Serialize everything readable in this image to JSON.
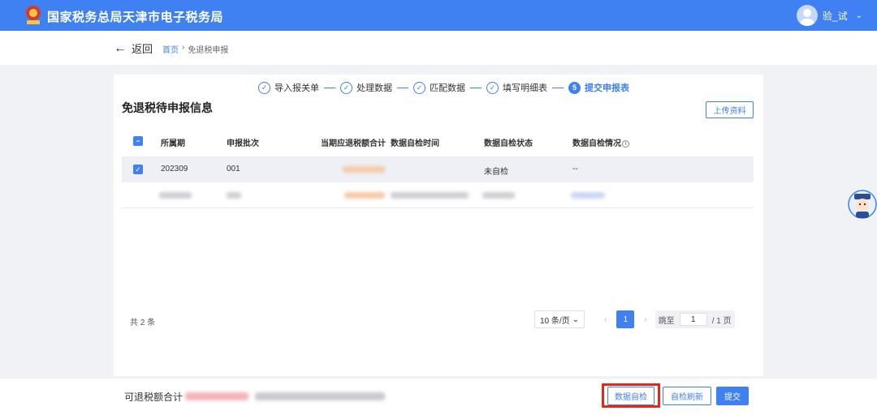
{
  "header": {
    "title": "国家税务总局天津市电子税务局",
    "user_name": "验_试",
    "colors": {
      "brand": "#3f80f2",
      "highlight": "#e4261b"
    }
  },
  "nav": {
    "back_label": "返回",
    "breadcrumb": [
      "首页",
      "免退税申报"
    ],
    "breadcrumb_sep": "›"
  },
  "steps": [
    {
      "label": "导入报关单",
      "status": "done"
    },
    {
      "label": "处理数据",
      "status": "done"
    },
    {
      "label": "匹配数据",
      "status": "done"
    },
    {
      "label": "填写明细表",
      "status": "done"
    },
    {
      "label": "提交申报表",
      "status": "active",
      "number": "5"
    }
  ],
  "section": {
    "title": "免退税待申报信息",
    "upload_label": "上传资料"
  },
  "table": {
    "columns": [
      "所属期",
      "申报批次",
      "当期应退税额合计",
      "数据自检时间",
      "数据自检状态",
      "数据自检情况"
    ],
    "rows": [
      {
        "period": "202309",
        "batch": "001",
        "refund": "",
        "check_time": "",
        "check_status": "未自检",
        "check_detail": "--",
        "selected": true
      }
    ]
  },
  "pagination": {
    "total": "共 2 条",
    "page_size": "10 条/页",
    "prev": "‹",
    "current": "1",
    "next": "›",
    "jump_label": "跳至",
    "jump_value": "1",
    "total_pages": "/ 1 页"
  },
  "footer": {
    "sum_label": "可退税额合计",
    "self_check_label": "数据自检",
    "refresh_label": "自检刷新",
    "submit_label": "提交"
  },
  "icons": [
    "emblem-icon",
    "avatar-icon",
    "chevron-down-icon",
    "arrow-left-icon",
    "check-circle-icon",
    "checkbox-icon",
    "info-icon",
    "assistant-icon"
  ]
}
